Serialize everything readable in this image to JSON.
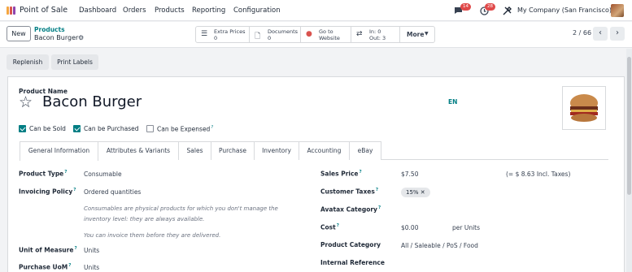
{
  "navbar": {
    "app_name": "Point of Sale",
    "menu": [
      "Dashboard",
      "Orders",
      "Products",
      "Reporting",
      "Configuration"
    ],
    "messages_badge": "14",
    "activities_badge": "28",
    "company": "My Company (San Francisco)",
    "icons": [
      "apps-icon",
      "chat-icon",
      "clock-icon",
      "tools-icon",
      "avatar"
    ]
  },
  "control": {
    "new_label": "New",
    "breadcrumb_parent": "Products",
    "breadcrumb_current": "Bacon Burger",
    "smart_buttons": [
      {
        "icon": "list-icon",
        "line1": "Extra Prices",
        "line2": "0"
      },
      {
        "icon": "document-icon",
        "line1": "Documents",
        "line2": "0"
      },
      {
        "icon": "globe-icon",
        "line1": "Go to",
        "line2": "Website"
      },
      {
        "icon": "transfer-icon",
        "line1": "In: 0",
        "line2": "Out: 3"
      }
    ],
    "more_label": "More",
    "pager": "2 / 66"
  },
  "actions": [
    "Replenish",
    "Print Labels"
  ],
  "form": {
    "name_label": "Product Name",
    "name": "Bacon Burger",
    "lang": "EN",
    "checkboxes": [
      {
        "label": "Can be Sold",
        "checked": true
      },
      {
        "label": "Can be Purchased",
        "checked": true
      },
      {
        "label": "Can be Expensed",
        "checked": false
      }
    ],
    "tabs": [
      "General Information",
      "Attributes & Variants",
      "Sales",
      "Purchase",
      "Inventory",
      "Accounting",
      "eBay"
    ],
    "left_fields": {
      "product_type_label": "Product Type",
      "product_type": "Consumable",
      "invoicing_policy_label": "Invoicing Policy",
      "invoicing_policy": "Ordered quantities",
      "help1a": "Consumables are physical products for which you don't manage the",
      "help1b": "inventory level: they are always available.",
      "help2": "You can invoice them before they are delivered.",
      "uom_label": "Unit of Measure",
      "uom": "Units",
      "purchase_uom_label": "Purchase UoM",
      "purchase_uom": "Units"
    },
    "right_fields": {
      "sales_price_label": "Sales Price",
      "sales_price": "$7.50",
      "incl_taxes": "(= $ 8.63 Incl. Taxes)",
      "customer_taxes_label": "Customer Taxes",
      "customer_taxes_tag": "15%",
      "avatax_label": "Avatax Category",
      "cost_label": "Cost",
      "cost": "$0.00",
      "per_units": "per Units",
      "category_label": "Product Category",
      "category": "All / Saleable / PoS / Food",
      "internal_ref_label": "Internal Reference"
    }
  },
  "colors": {
    "accent": "#017e84",
    "badge": "#e04a4a",
    "brand_icon": [
      "#f4a640",
      "#d9534f",
      "#8e44ad"
    ]
  }
}
